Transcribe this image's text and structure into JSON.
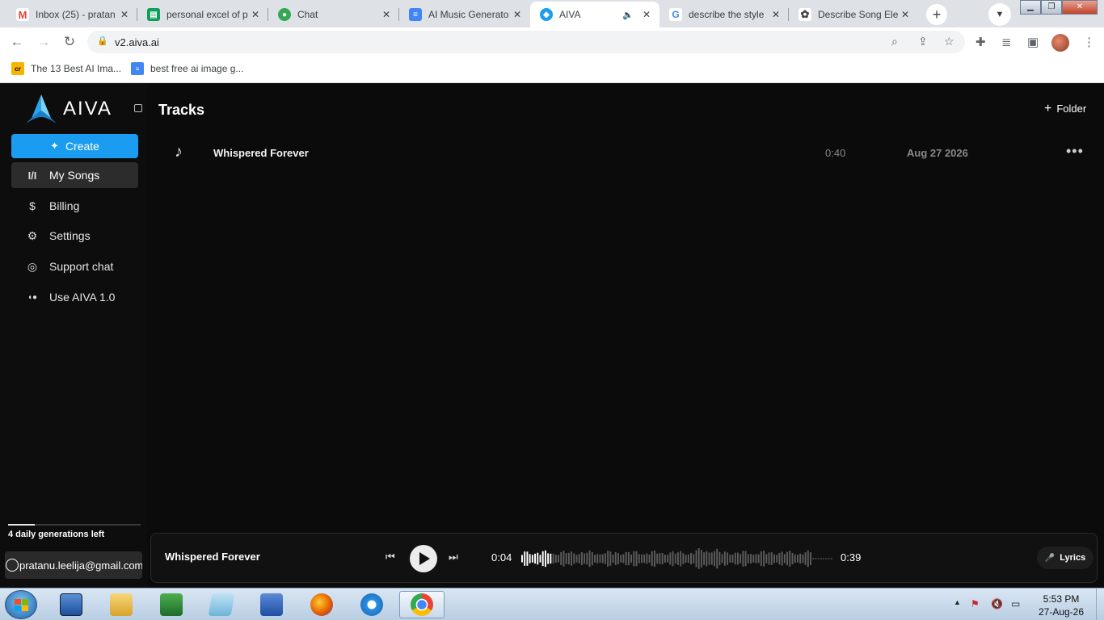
{
  "browser": {
    "tabs": [
      {
        "title": "Inbox (25) - pratan",
        "favicon": "gmail-icon",
        "color": "#ea4335"
      },
      {
        "title": "personal excel of p",
        "favicon": "sheets-icon",
        "color": "#0f9d58"
      },
      {
        "title": "Chat",
        "favicon": "chat-icon",
        "color": "#34a853"
      },
      {
        "title": "AI Music Generato",
        "favicon": "docs-icon",
        "color": "#4285f4"
      },
      {
        "title": "AIVA",
        "favicon": "aiva-icon",
        "color": "#1a9df0",
        "active": true
      },
      {
        "title": "describe the style",
        "favicon": "google-icon",
        "color": "#4285f4"
      },
      {
        "title": "Describe Song Ele",
        "favicon": "openai-icon",
        "color": "#444444"
      }
    ],
    "url": "v2.aiva.ai",
    "bookmarks": [
      {
        "label": "The 13 Best AI Ima...",
        "favicon": "cr-icon",
        "color": "#f5b400"
      },
      {
        "label": "best free ai image g...",
        "favicon": "docs-icon",
        "color": "#4285f4"
      }
    ]
  },
  "app": {
    "brand": "AIVA",
    "accent": "#1a9df0",
    "create_label": "Create",
    "nav": [
      {
        "label": "My Songs",
        "icon": "songs-icon",
        "glyph": "I/I",
        "active": true
      },
      {
        "label": "Billing",
        "icon": "dollar-icon",
        "glyph": "$"
      },
      {
        "label": "Settings",
        "icon": "gear-icon",
        "glyph": "⚙"
      },
      {
        "label": "Support chat",
        "icon": "support-icon",
        "glyph": "◎"
      },
      {
        "label": "Use AIVA 1.0",
        "icon": "toggle-icon",
        "glyph": "⬤"
      }
    ],
    "generations_text": "4 daily generations left",
    "generations_progress": 0.2,
    "account_email": "pratanu.leelija@gmail.com"
  },
  "main": {
    "title": "Tracks",
    "folder_label": "Folder",
    "tracks": [
      {
        "name": "Whispered Forever",
        "duration": "0:40",
        "date": "Aug 27 2026"
      }
    ]
  },
  "player": {
    "title": "Whispered Forever",
    "current_time": "0:04",
    "total_time": "0:39",
    "lyrics_label": "Lyrics",
    "progress": 0.1
  },
  "taskbar": {
    "time": "5:53 PM",
    "date": "27-Aug-26"
  }
}
